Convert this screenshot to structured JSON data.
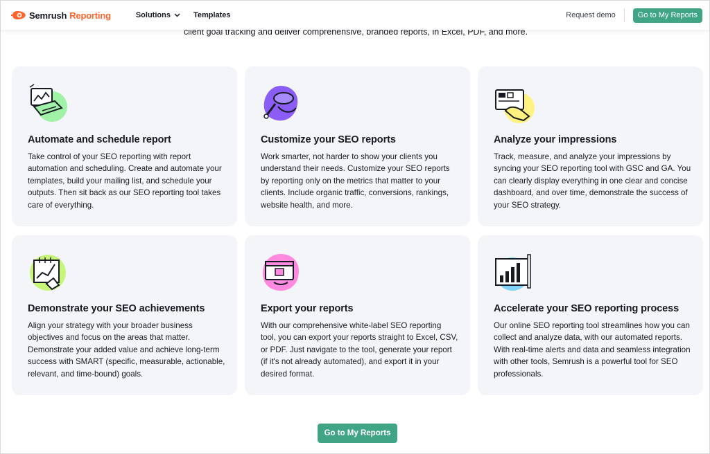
{
  "header": {
    "brand": "Semrush",
    "product": "Reporting",
    "nav": [
      {
        "label": "Solutions"
      },
      {
        "label": "Templates"
      }
    ],
    "request_demo": "Request demo",
    "cta": "Go to My Reports"
  },
  "intro_text": "client goal tracking and deliver comprehensive, branded reports, in Excel, PDF, and more.",
  "features": [
    {
      "icon": "laptop-chart-icon",
      "title": "Automate and schedule report",
      "description": "Take control of your SEO reporting with report automation and scheduling. Create and automate your templates, build your mailing list, and schedule your outputs. Then sit back as our SEO reporting tool takes care of everything."
    },
    {
      "icon": "paint-roller-icon",
      "title": "Customize your SEO reports",
      "description": "Work smarter, not harder to show your clients you understand their needs. Customize your SEO reports by reporting only on the metrics that matter to your clients. Include organic traffic, conversions, rankings, website health, and more."
    },
    {
      "icon": "dashboard-hand-icon",
      "title": "Analyze your impressions",
      "description": "Track, measure, and analyze your impressions by syncing your SEO reporting tool with GSC and GA. You can clearly display everything in one clear and concise dashboard, and over time, demonstrate the success of your SEO strategy."
    },
    {
      "icon": "growth-chart-icon",
      "title": "Demonstrate your SEO achievements",
      "description": "Align your strategy with your broader business objectives and focus on the areas that matter. Demonstrate your added value and achieve long-term success with SMART (specific, measurable, actionable, relevant, and time-bound) goals."
    },
    {
      "icon": "export-window-icon",
      "title": "Export your reports",
      "description": "With our comprehensive white-label SEO reporting tool, you can export your reports straight to Excel, CSV, or PDF. Just navigate to the tool, generate your report (if it's not already automated), and export it in your desired format."
    },
    {
      "icon": "bar-chart-icon",
      "title": "Accelerate your SEO reporting process",
      "description": "Our online SEO reporting tool streamlines how you can collect and analyze data, with our automated reports. With real-time alerts and data and seamless integration with other tools, Semrush is a powerful tool for SEO professionals."
    }
  ],
  "bottom_cta": "Go to My Reports",
  "colors": {
    "accent": "#3fa584",
    "brand_orange": "#ff642d",
    "card_bg": "#f4f5f9"
  }
}
